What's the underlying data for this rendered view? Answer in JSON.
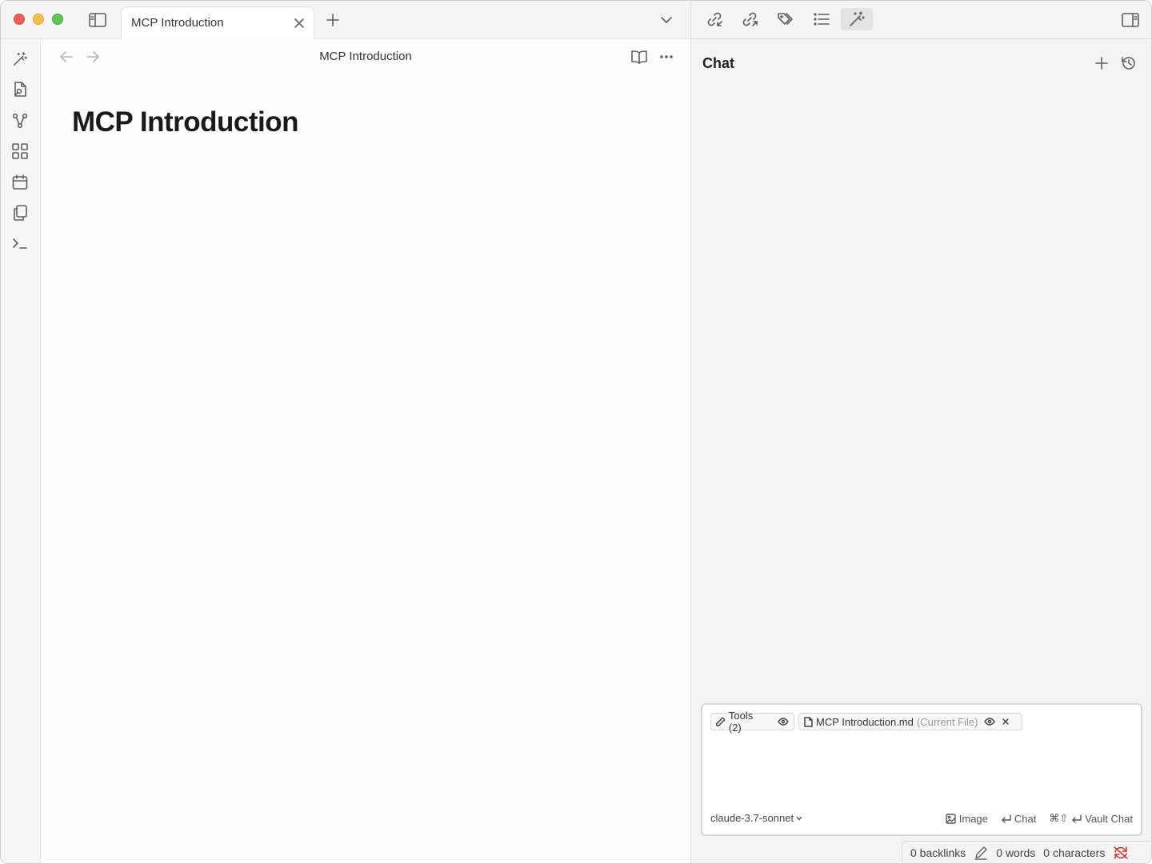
{
  "tab": {
    "title": "MCP Introduction"
  },
  "editor": {
    "header_title": "MCP Introduction",
    "heading": "MCP Introduction"
  },
  "side_panel": {
    "title": "Chat",
    "chips": {
      "tools_label": "Tools (2)",
      "file_name": "MCP Introduction.md",
      "file_note": "(Current File)"
    },
    "model": "claude-3.7-sonnet",
    "actions": {
      "image": "Image",
      "chat": "Chat",
      "vault_chat_shortcut": "⌘⇧",
      "vault_chat": "Vault Chat"
    }
  },
  "status": {
    "backlinks": "0 backlinks",
    "words": "0 words",
    "characters": "0 characters"
  },
  "icons": {
    "ribbon": [
      "magic-wand-icon",
      "file-search-icon",
      "graph-icon",
      "grid-icon",
      "calendar-icon",
      "copy-icon",
      "terminal-icon"
    ],
    "side_toolbar": [
      "link-in-icon",
      "link-out-icon",
      "tags-icon",
      "outline-icon",
      "magic-wand-icon"
    ]
  },
  "colors": {
    "traffic_red": "#ec5f58",
    "traffic_yellow": "#f4bf4f",
    "traffic_green": "#5fc454",
    "sync_error": "#c0392b"
  }
}
